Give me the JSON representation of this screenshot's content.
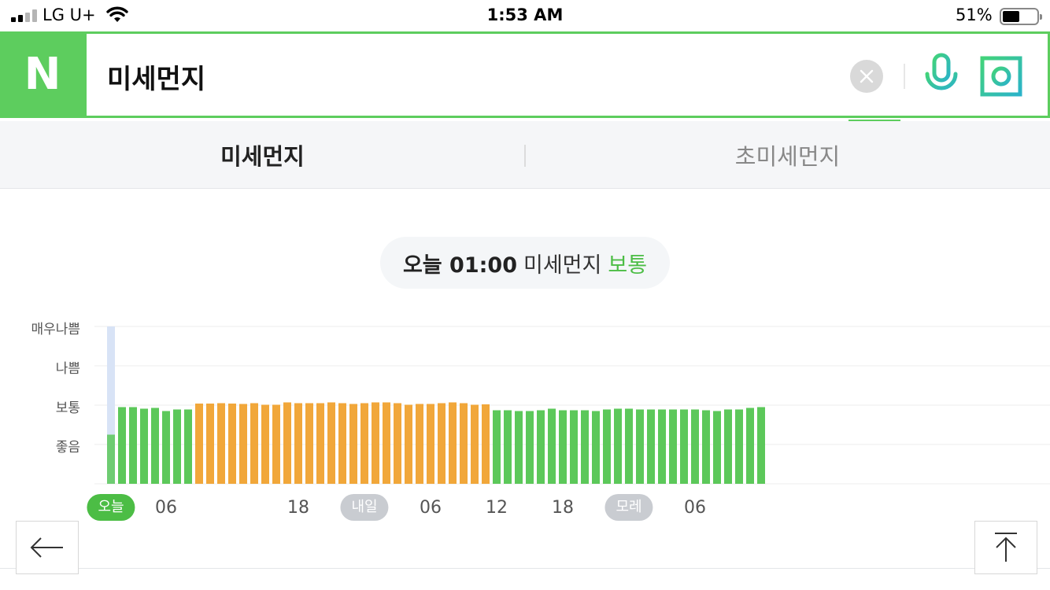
{
  "status_bar": {
    "carrier": "LG U+",
    "time": "1:53 AM",
    "battery_percent": "51%",
    "battery_level": 0.51,
    "icons": [
      "cellular-signal-icon",
      "wifi-icon",
      "battery-icon"
    ]
  },
  "search": {
    "logo": "N",
    "query": "미세먼지",
    "clear_icon": "close-icon",
    "voice_icon": "microphone-icon",
    "lens_icon": "camera-lens-icon",
    "brand_color": "#5dcd5e"
  },
  "tabs": [
    {
      "label": "미세먼지",
      "selected": true
    },
    {
      "label": "초미세먼지",
      "selected": false
    }
  ],
  "status_pill": {
    "when": "오늘 01:00",
    "type": "미세먼지",
    "grade": "보통",
    "grade_color": "#4cbd45"
  },
  "chart_data": {
    "type": "bar",
    "y_levels": [
      "좋음",
      "보통",
      "나쁨",
      "매우나쁨"
    ],
    "ylim": [
      0,
      4
    ],
    "x_labels": [
      {
        "text": "오늘",
        "badge": true,
        "style": "today",
        "index": 0
      },
      {
        "text": "06",
        "badge": false,
        "index": 5
      },
      {
        "text": "18",
        "badge": false,
        "index": 17
      },
      {
        "text": "내일",
        "badge": true,
        "style": "day",
        "index": 23
      },
      {
        "text": "06",
        "badge": false,
        "index": 29
      },
      {
        "text": "12",
        "badge": false,
        "index": 35
      },
      {
        "text": "18",
        "badge": false,
        "index": 41
      },
      {
        "text": "모레",
        "badge": true,
        "style": "day",
        "index": 47
      },
      {
        "text": "06",
        "badge": false,
        "index": 53
      }
    ],
    "colors": {
      "good": "#5cc85a",
      "normal": "#f1a73a",
      "current_bg": "#d8e3f6"
    },
    "current_index": 0,
    "values": [
      1.25,
      1.95,
      1.95,
      1.91,
      1.93,
      1.85,
      1.89,
      1.89,
      2.04,
      2.04,
      2.05,
      2.04,
      2.03,
      2.05,
      2.01,
      2.01,
      2.07,
      2.05,
      2.05,
      2.05,
      2.07,
      2.05,
      2.03,
      2.05,
      2.07,
      2.07,
      2.05,
      2.01,
      2.03,
      2.03,
      2.05,
      2.07,
      2.05,
      2.01,
      2.02,
      1.87,
      1.87,
      1.85,
      1.85,
      1.87,
      1.91,
      1.87,
      1.87,
      1.87,
      1.85,
      1.89,
      1.91,
      1.91,
      1.89,
      1.89,
      1.89,
      1.89,
      1.89,
      1.89,
      1.87,
      1.85,
      1.89,
      1.89,
      1.93,
      1.95
    ],
    "categories": [
      "good",
      "good",
      "good",
      "good",
      "good",
      "good",
      "good",
      "good",
      "normal",
      "normal",
      "normal",
      "normal",
      "normal",
      "normal",
      "normal",
      "normal",
      "normal",
      "normal",
      "normal",
      "normal",
      "normal",
      "normal",
      "normal",
      "normal",
      "normal",
      "normal",
      "normal",
      "normal",
      "normal",
      "normal",
      "normal",
      "normal",
      "normal",
      "normal",
      "normal",
      "good",
      "good",
      "good",
      "good",
      "good",
      "good",
      "good",
      "good",
      "good",
      "good",
      "good",
      "good",
      "good",
      "good",
      "good",
      "good",
      "good",
      "good",
      "good",
      "good",
      "good",
      "good",
      "good",
      "good",
      "good"
    ]
  },
  "buttons": {
    "back_icon": "arrow-left-icon",
    "top_icon": "arrow-up-to-top-icon"
  }
}
